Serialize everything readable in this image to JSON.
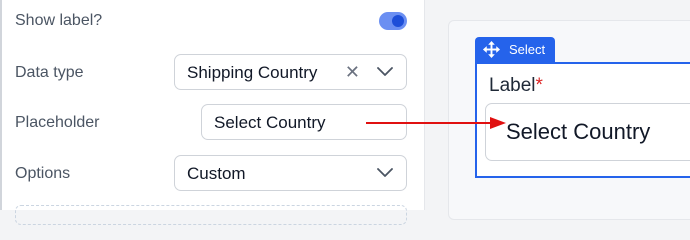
{
  "settings": {
    "show_label": {
      "label": "Show label?",
      "enabled": true
    },
    "data_type": {
      "label": "Data type",
      "value": "Shipping Country",
      "clear_icon": "close-icon",
      "dropdown_icon": "chevron-down-icon"
    },
    "placeholder": {
      "label": "Placeholder",
      "value": "Select Country"
    },
    "options": {
      "label": "Options",
      "value": "Custom",
      "dropdown_icon": "chevron-down-icon"
    }
  },
  "canvas": {
    "select_tag": {
      "label": "Select",
      "icon": "move-icon"
    },
    "field": {
      "label": "Label",
      "required_mark": "*",
      "placeholder": "Select Country"
    }
  },
  "colors": {
    "accent": "#2563eb",
    "toggle_track": "#6b8ff2",
    "required": "#dc2626",
    "annotation_arrow": "#e01010"
  }
}
